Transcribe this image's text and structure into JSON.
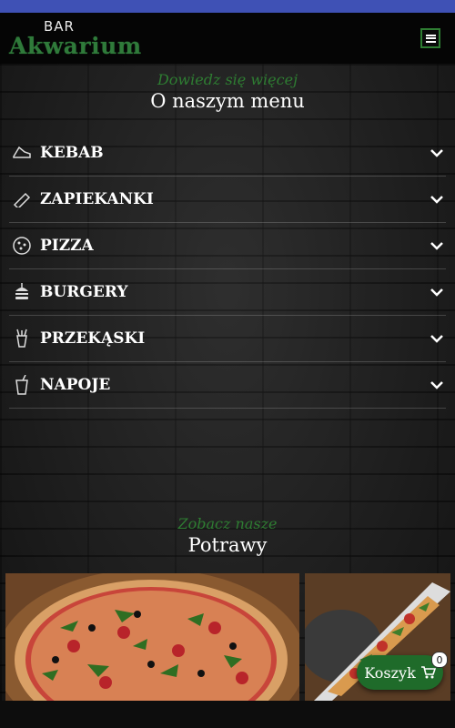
{
  "colors": {
    "accent": "#2e7d32",
    "topbar": "#3f51b5",
    "cart_bg": "#1f6b2a"
  },
  "header": {
    "logo_small": "BAR",
    "logo_name": "Akwarium",
    "menu_icon": "hamburger-icon"
  },
  "menu_section": {
    "kicker": "Dowiedz się więcej",
    "title": "O naszym menu",
    "items": [
      {
        "label": "KEBAB",
        "icon": "kebab-icon"
      },
      {
        "label": "ZAPIEKANKI",
        "icon": "zapiekanka-icon"
      },
      {
        "label": "PIZZA",
        "icon": "pizza-icon"
      },
      {
        "label": "BURGERY",
        "icon": "burger-icon"
      },
      {
        "label": "PRZEKĄSKI",
        "icon": "snack-icon"
      },
      {
        "label": "NAPOJE",
        "icon": "drink-icon"
      }
    ]
  },
  "dishes_section": {
    "kicker": "Zobacz nasze",
    "title": "Potrawy"
  },
  "cart": {
    "label": "Koszyk",
    "count": "0",
    "icon": "shopping-cart-icon"
  }
}
